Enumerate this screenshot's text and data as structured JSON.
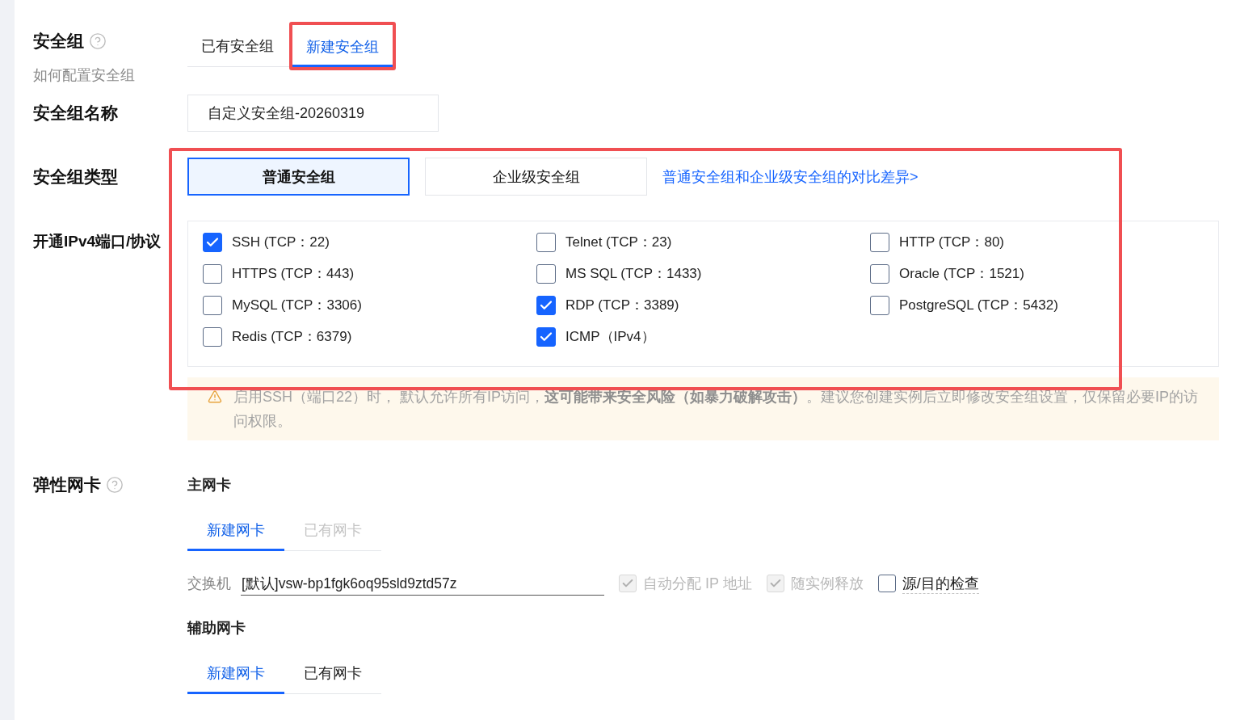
{
  "security_group": {
    "label": "安全组",
    "help_link": "如何配置安全组",
    "tabs": [
      {
        "label": "已有安全组",
        "selected": false,
        "highlighted": false
      },
      {
        "label": "新建安全组",
        "selected": true,
        "highlighted": true
      }
    ]
  },
  "group_name": {
    "label": "安全组名称",
    "value": "自定义安全组-20260319"
  },
  "framed_section": {
    "highlighted": true,
    "group_type": {
      "label": "安全组类型",
      "options": [
        {
          "label": "普通安全组",
          "selected": true
        },
        {
          "label": "企业级安全组",
          "selected": false
        }
      ],
      "compare_link": "普通安全组和企业级安全组的对比差异>"
    },
    "ports": {
      "label": "开通IPv4端口/协议",
      "items": [
        {
          "label": "SSH (TCP：22)",
          "checked": true
        },
        {
          "label": "Telnet (TCP：23)",
          "checked": false
        },
        {
          "label": "HTTP (TCP：80)",
          "checked": false
        },
        {
          "label": "HTTPS (TCP：443)",
          "checked": false
        },
        {
          "label": "MS SQL (TCP：1433)",
          "checked": false
        },
        {
          "label": "Oracle (TCP：1521)",
          "checked": false
        },
        {
          "label": "MySQL (TCP：3306)",
          "checked": false
        },
        {
          "label": "RDP (TCP：3389)",
          "checked": true
        },
        {
          "label": "PostgreSQL (TCP：5432)",
          "checked": false
        },
        {
          "label": "Redis (TCP：6379)",
          "checked": false
        },
        {
          "label": "ICMP（IPv4）",
          "checked": true
        }
      ]
    }
  },
  "warning": {
    "text": "启用SSH（端口22）时， 默认允许所有IP访问，**这可能带来安全风险（如暴力破解攻击）**。建议您创建实例后立即修改安全组设置，仅保留必要IP的访问权限。"
  },
  "elastic_nic": {
    "label": "弹性网卡",
    "primary": {
      "title": "主网卡",
      "tabs": [
        {
          "label": "新建网卡",
          "selected": true,
          "disabled": false
        },
        {
          "label": "已有网卡",
          "selected": false,
          "disabled": true
        }
      ],
      "switch": {
        "label": "交换机",
        "value": "[默认]vsw-bp1fgk6oq95sld9ztd57z"
      },
      "options": [
        {
          "label": "自动分配 IP 地址",
          "checked": true,
          "disabled": true,
          "tooltip": false
        },
        {
          "label": "随实例释放",
          "checked": true,
          "disabled": true,
          "tooltip": false
        },
        {
          "label": "源/目的检查",
          "checked": false,
          "disabled": false,
          "tooltip": true
        }
      ]
    },
    "secondary": {
      "title": "辅助网卡",
      "tabs": [
        {
          "label": "新建网卡",
          "selected": true,
          "disabled": false
        },
        {
          "label": "已有网卡",
          "selected": false,
          "disabled": false
        }
      ]
    }
  }
}
